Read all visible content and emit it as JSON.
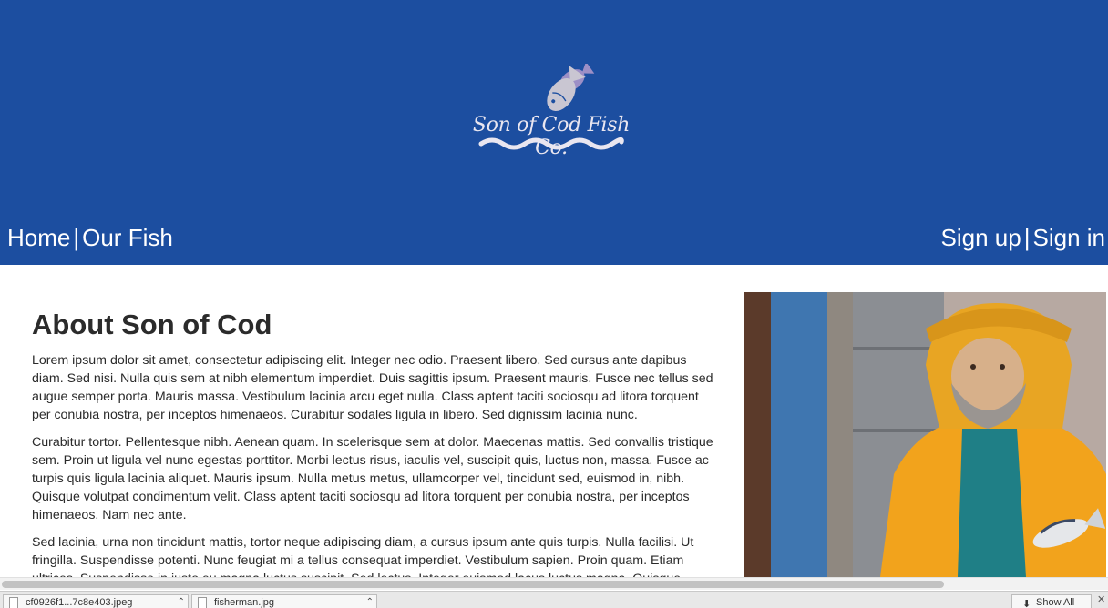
{
  "header": {
    "logo_text": "Son of Cod Fish Co.",
    "bg_color": "#1c4ea0",
    "nav_left": [
      {
        "label": "Home"
      },
      {
        "label": "Our Fish"
      }
    ],
    "nav_right": [
      {
        "label": "Sign up"
      },
      {
        "label": "Sign in"
      }
    ],
    "separator": "|"
  },
  "main": {
    "title": "About Son of Cod",
    "paragraphs": [
      "Lorem ipsum dolor sit amet, consectetur adipiscing elit. Integer nec odio. Praesent libero. Sed cursus ante dapibus diam. Sed nisi. Nulla quis sem at nibh elementum imperdiet. Duis sagittis ipsum. Praesent mauris. Fusce nec tellus sed augue semper porta. Mauris massa. Vestibulum lacinia arcu eget nulla. Class aptent taciti sociosqu ad litora torquent per conubia nostra, per inceptos himenaeos. Curabitur sodales ligula in libero. Sed dignissim lacinia nunc.",
      "Curabitur tortor. Pellentesque nibh. Aenean quam. In scelerisque sem at dolor. Maecenas mattis. Sed convallis tristique sem. Proin ut ligula vel nunc egestas porttitor. Morbi lectus risus, iaculis vel, suscipit quis, luctus non, massa. Fusce ac turpis quis ligula lacinia aliquet. Mauris ipsum. Nulla metus metus, ullamcorper vel, tincidunt sed, euismod in, nibh. Quisque volutpat condimentum velit. Class aptent taciti sociosqu ad litora torquent per conubia nostra, per inceptos himenaeos. Nam nec ante.",
      "Sed lacinia, urna non tincidunt mattis, tortor neque adipiscing diam, a cursus ipsum ante quis turpis. Nulla facilisi. Ut fringilla. Suspendisse potenti. Nunc feugiat mi a tellus consequat imperdiet. Vestibulum sapien. Proin quam. Etiam ultrices. Suspendisse in justo eu magna luctus suscipit. Sed lectus. Integer euismod lacus luctus magna. Quisque cursus, metus vitae pharetra auctor, sem massa mattis sem, at interdum magna augue eget diam."
    ],
    "image_icon": "fisherman-photo"
  },
  "browser": {
    "downloads": [
      {
        "name": "cf0926f1...7c8e403.jpeg"
      },
      {
        "name": "fisherman.jpg"
      }
    ],
    "show_all_label": "Show All",
    "close_icon": "close-icon"
  }
}
